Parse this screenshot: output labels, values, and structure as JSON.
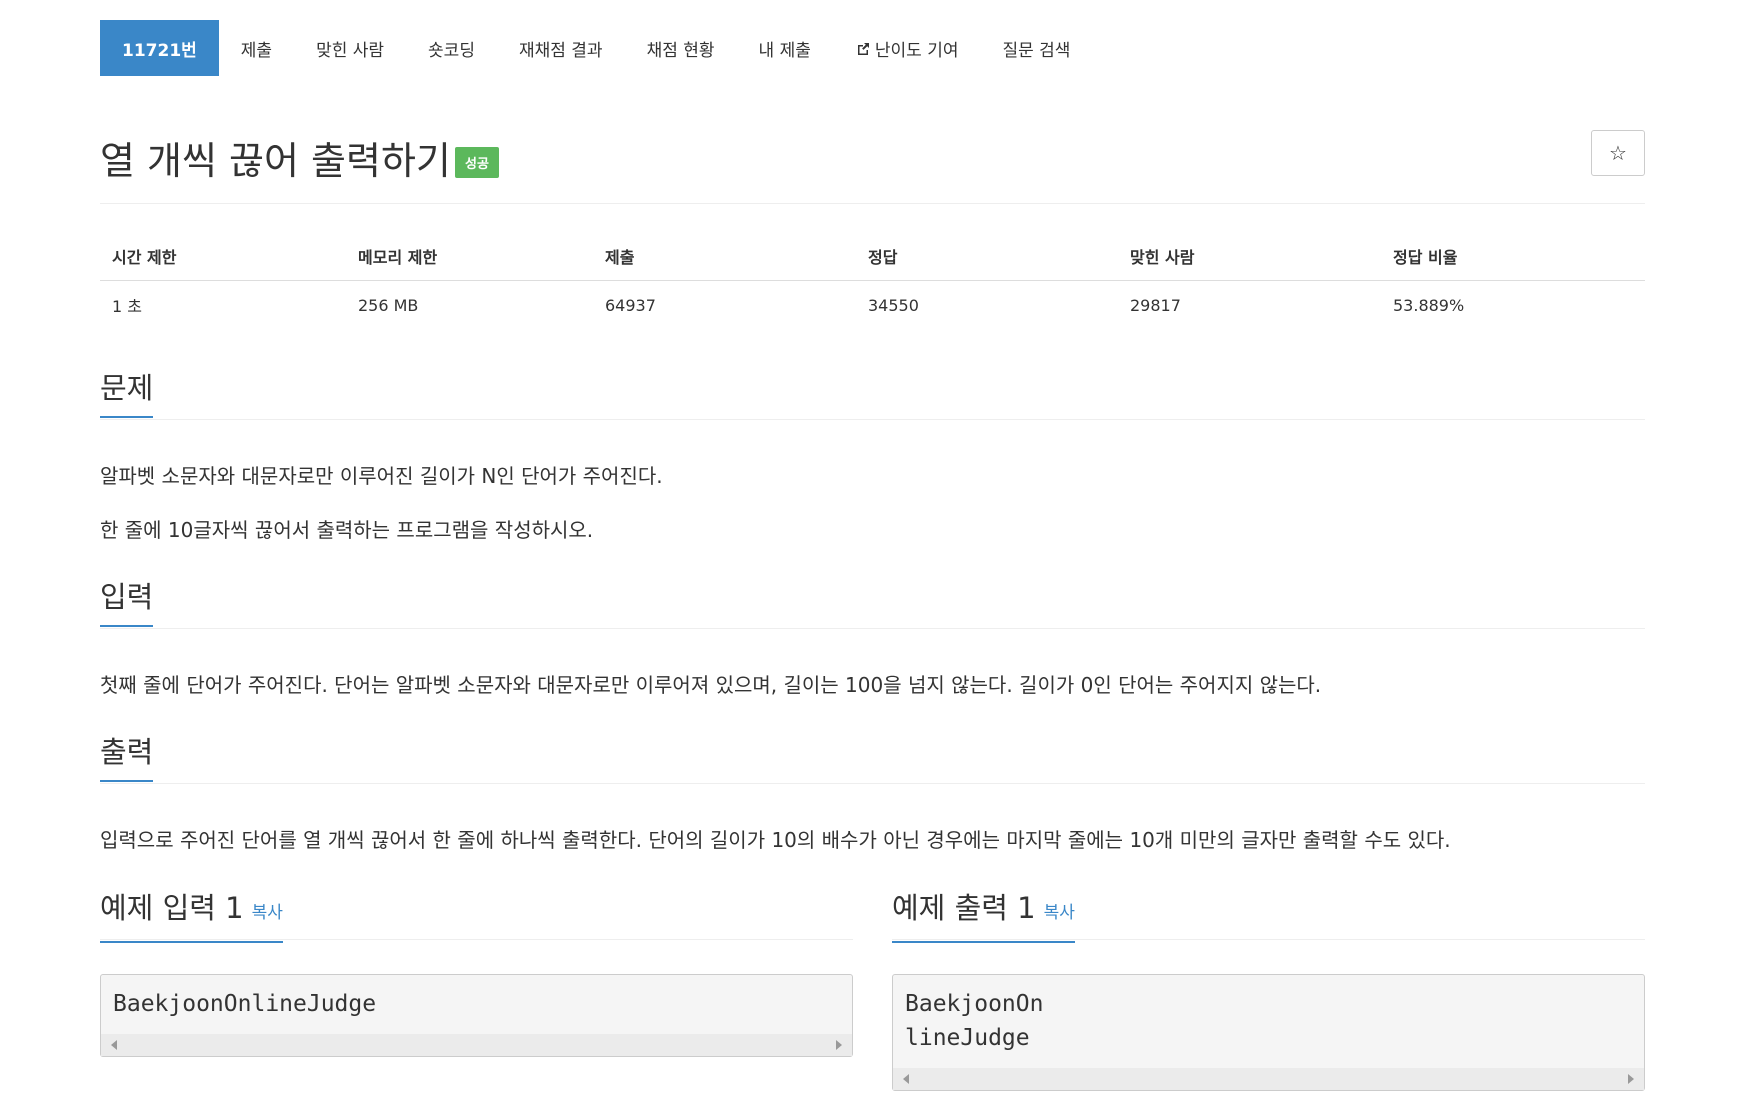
{
  "tabs": [
    {
      "label": "11721번",
      "active": true
    },
    {
      "label": "제출"
    },
    {
      "label": "맞힌 사람"
    },
    {
      "label": "숏코딩"
    },
    {
      "label": "재채점 결과"
    },
    {
      "label": "채점 현황"
    },
    {
      "label": "내 제출"
    },
    {
      "label": "난이도 기여",
      "icon": "external-link-icon"
    },
    {
      "label": "질문 검색"
    }
  ],
  "problem": {
    "title": "열 개씩 끊어 출력하기",
    "status_badge": "성공",
    "star_icon": "☆"
  },
  "info_table": {
    "headers": [
      "시간 제한",
      "메모리 제한",
      "제출",
      "정답",
      "맞힌 사람",
      "정답 비율"
    ],
    "values": [
      "1 초",
      "256 MB",
      "64937",
      "34550",
      "29817",
      "53.889%"
    ]
  },
  "sections": {
    "problem": {
      "title": "문제",
      "lines": [
        "알파벳 소문자와 대문자로만 이루어진 길이가 N인 단어가 주어진다.",
        "한 줄에 10글자씩 끊어서 출력하는 프로그램을 작성하시오."
      ]
    },
    "input": {
      "title": "입력",
      "text": "첫째 줄에 단어가 주어진다. 단어는 알파벳 소문자와 대문자로만 이루어져 있으며, 길이는 100을 넘지 않는다. 길이가 0인 단어는 주어지지 않는다."
    },
    "output": {
      "title": "출력",
      "text": "입력으로 주어진 단어를 열 개씩 끊어서 한 줄에 하나씩 출력한다. 단어의 길이가 10의 배수가 아닌 경우에는 마지막 줄에는 10개 미만의 글자만 출력할 수도 있다."
    }
  },
  "samples": {
    "input": {
      "title": "예제 입력 1",
      "copy": "복사",
      "content": "BaekjoonOnlineJudge"
    },
    "output": {
      "title": "예제 출력 1",
      "copy": "복사",
      "content": "BaekjoonOn\nlineJudge"
    }
  },
  "colors": {
    "accent": "#3a87c8",
    "success": "#5cb85c"
  }
}
